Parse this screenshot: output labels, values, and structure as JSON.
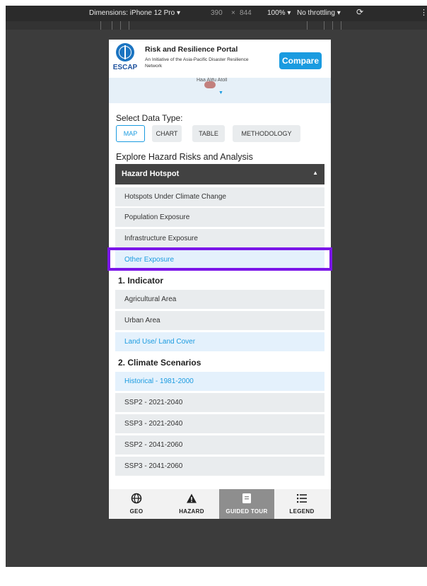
{
  "devtools": {
    "dimensions": "Dimensions: iPhone 12 Pro ▾",
    "width": "390",
    "x": "×",
    "height": "844",
    "zoom": "100% ▾",
    "throttle": "No throttling ▾",
    "rotate_icon": "⟳",
    "more_icon": "⋮"
  },
  "header": {
    "logo_text": "ESCAP",
    "title": "Risk and Resilience Portal",
    "subtitle": "An Initiative of the Asia-Pacific Disaster Resilience Network",
    "compare_label": "Compare"
  },
  "map": {
    "partial_label": "Haa Alifu Atoll"
  },
  "data_type": {
    "label": "Select Data Type:",
    "tabs": [
      "MAP",
      "CHART",
      "TABLE",
      "METHODOLOGY"
    ],
    "active": "MAP"
  },
  "explore": {
    "label": "Explore Hazard Risks and Analysis",
    "dropdown_label": "Hazard Hotspot",
    "dropdown_caret": "▲",
    "options": [
      "Hotspots Under Climate Change",
      "Population Exposure",
      "Infrastructure Exposure",
      "Other Exposure"
    ],
    "selected_option": "Other Exposure"
  },
  "indicator": {
    "title": "1. Indicator",
    "options": [
      "Agricultural Area",
      "Urban Area",
      "Land Use/ Land Cover"
    ],
    "selected": "Land Use/ Land Cover"
  },
  "climate": {
    "title": "2. Climate Scenarios",
    "options": [
      "Historical - 1981-2000",
      "SSP2 - 2021-2040",
      "SSP3 - 2021-2040",
      "SSP2 - 2041-2060",
      "SSP3 - 2041-2060"
    ],
    "selected": "Historical - 1981-2000"
  },
  "bottom_nav": {
    "items": [
      {
        "label": "GEO",
        "icon": "globe-icon",
        "glyph": "🌐"
      },
      {
        "label": "HAZARD",
        "icon": "warning-icon",
        "glyph": "▲"
      },
      {
        "label": "GUIDED TOUR",
        "icon": "book-icon",
        "glyph": "▤"
      },
      {
        "label": "LEGEND",
        "icon": "list-icon",
        "glyph": "☰"
      }
    ],
    "active": "GUIDED TOUR"
  },
  "colors": {
    "accent": "#1a9be0",
    "highlight": "#7b16e8",
    "dropdown_bg": "#424242",
    "row_bg": "#e9ecee",
    "selected_bg": "#e4f1fc"
  }
}
